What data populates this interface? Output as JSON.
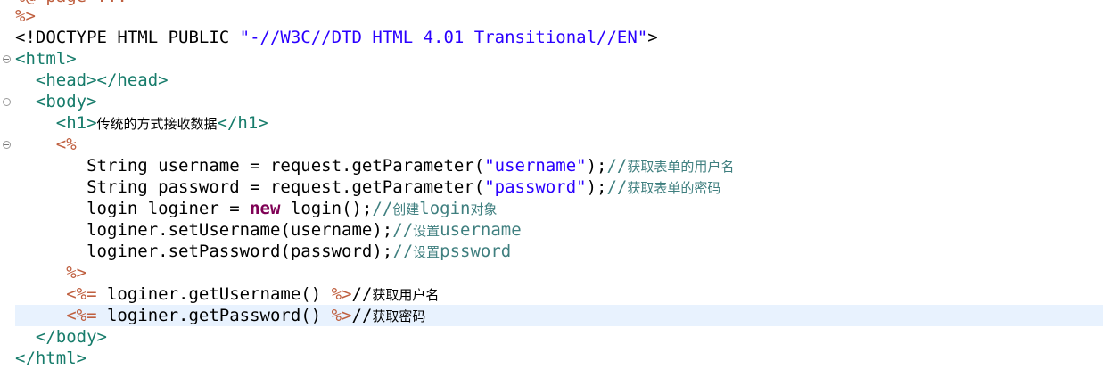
{
  "editor": {
    "lines": [
      {
        "indent": "",
        "parts": [
          {
            "t": "%>",
            "c": "jsp"
          }
        ]
      },
      {
        "indent": "",
        "parts": [
          {
            "t": "<!DOCTYPE HTML PUBLIC ",
            "c": "doctype"
          },
          {
            "t": "\"-//W3C//DTD HTML 4.01 Transitional//EN\"",
            "c": "str"
          },
          {
            "t": ">",
            "c": "doctype"
          }
        ]
      },
      {
        "indent": "",
        "parts": [
          {
            "t": "<html>",
            "c": "tag"
          }
        ]
      },
      {
        "indent": "  ",
        "parts": [
          {
            "t": "<head></head>",
            "c": "tag"
          }
        ]
      },
      {
        "indent": "  ",
        "parts": [
          {
            "t": "<body>",
            "c": "tag"
          }
        ]
      },
      {
        "indent": "    ",
        "parts": [
          {
            "t": "<h1>",
            "c": "tag"
          },
          {
            "t": "传统的方式接收数据",
            "c": "cjk-dark"
          },
          {
            "t": "</h1>",
            "c": "tag"
          }
        ]
      },
      {
        "indent": "    ",
        "parts": [
          {
            "t": "<%",
            "c": "jsp"
          }
        ]
      },
      {
        "indent": "       ",
        "parts": [
          {
            "t": "String username = request.getParameter(",
            "c": "plain"
          },
          {
            "t": "\"username\"",
            "c": "str"
          },
          {
            "t": ");",
            "c": "plain"
          },
          {
            "t": "//",
            "c": "cmt"
          },
          {
            "t": "获取表单的用户名",
            "c": "cmt-cjk"
          }
        ]
      },
      {
        "indent": "       ",
        "parts": [
          {
            "t": "String password = request.getParameter(",
            "c": "plain"
          },
          {
            "t": "\"password\"",
            "c": "str"
          },
          {
            "t": ");",
            "c": "plain"
          },
          {
            "t": "//",
            "c": "cmt"
          },
          {
            "t": "获取表单的密码",
            "c": "cmt-cjk"
          }
        ]
      },
      {
        "indent": "       ",
        "parts": [
          {
            "t": "login loginer = ",
            "c": "plain"
          },
          {
            "t": "new",
            "c": "kw"
          },
          {
            "t": " login();",
            "c": "plain"
          },
          {
            "t": "//",
            "c": "cmt"
          },
          {
            "t": "创建",
            "c": "cmt-cjk"
          },
          {
            "t": "login",
            "c": "cmt"
          },
          {
            "t": "对象",
            "c": "cmt-cjk"
          }
        ]
      },
      {
        "indent": "       ",
        "parts": [
          {
            "t": "loginer.setUsername(username);",
            "c": "plain"
          },
          {
            "t": "//",
            "c": "cmt"
          },
          {
            "t": "设置",
            "c": "cmt-cjk"
          },
          {
            "t": "username",
            "c": "cmt"
          }
        ]
      },
      {
        "indent": "       ",
        "parts": [
          {
            "t": "loginer.setPassword(password);",
            "c": "plain"
          },
          {
            "t": "//",
            "c": "cmt"
          },
          {
            "t": "设置",
            "c": "cmt-cjk"
          },
          {
            "t": "pssword",
            "c": "cmt"
          }
        ]
      },
      {
        "indent": "     ",
        "parts": [
          {
            "t": "%>",
            "c": "jsp"
          }
        ]
      },
      {
        "indent": "     ",
        "parts": [
          {
            "t": "<%=",
            "c": "jsp"
          },
          {
            "t": " loginer.getUsername() ",
            "c": "plain"
          },
          {
            "t": "%>",
            "c": "jsp"
          },
          {
            "t": "//",
            "c": "plain"
          },
          {
            "t": "获取用户名",
            "c": "cjk-dark"
          }
        ]
      },
      {
        "indent": "     ",
        "parts": [
          {
            "t": "<%=",
            "c": "jsp"
          },
          {
            "t": " loginer.getPassword() ",
            "c": "plain"
          },
          {
            "t": "%>",
            "c": "jsp"
          },
          {
            "t": "//",
            "c": "plain"
          },
          {
            "t": "获取密码",
            "c": "cjk-dark"
          }
        ]
      },
      {
        "indent": "  ",
        "parts": [
          {
            "t": "</body>",
            "c": "tag"
          }
        ]
      },
      {
        "indent": "",
        "parts": [
          {
            "t": "</html>",
            "c": "tag"
          }
        ]
      }
    ],
    "current_line": 14,
    "fold_lines": [
      2,
      4,
      6
    ]
  },
  "colors": {
    "tag": "#177c6b",
    "string": "#2a00ff",
    "jsp_delimiter": "#bf5f3f",
    "keyword": "#7f0055",
    "comment": "#3f7f7f",
    "current_line_bg": "#e8f2fe"
  }
}
